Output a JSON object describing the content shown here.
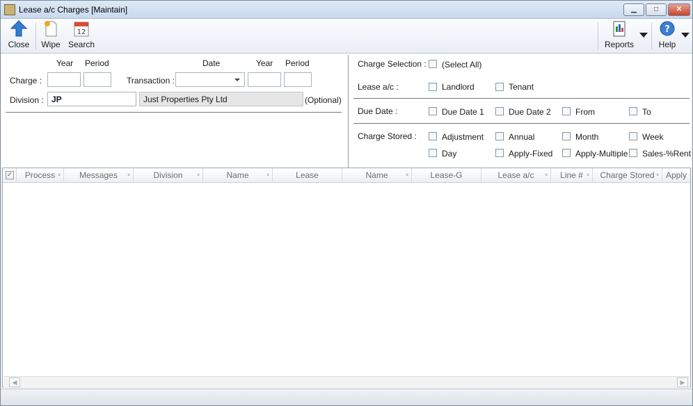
{
  "window": {
    "title": "Lease a/c Charges [Maintain]",
    "minimize_icon": "minimize-icon",
    "maximize_icon": "maximize-icon",
    "close_icon": "close-icon"
  },
  "toolbar": {
    "close_label": "Close",
    "wipe_label": "Wipe",
    "search_label": "Search",
    "reports_label": "Reports",
    "help_label": "Help"
  },
  "form": {
    "col_year_1": "Year",
    "col_period_1": "Period",
    "col_date": "Date",
    "col_year_2": "Year",
    "col_period_2": "Period",
    "charge_label": "Charge :",
    "transaction_label": "Transaction :",
    "division_label": "Division :",
    "division_value": "JP",
    "division_name": "Just Properties Pty Ltd",
    "optional_label": "(Optional)"
  },
  "selection": {
    "charge_selection_label": "Charge Selection :",
    "select_all": "(Select All)",
    "lease_ac_label": "Lease a/c :",
    "landlord": "Landlord",
    "tenant": "Tenant",
    "due_date_label": "Due Date :",
    "due_date_1": "Due Date 1",
    "due_date_2": "Due Date 2",
    "from": "From",
    "to": "To",
    "charge_stored_label": "Charge Stored :",
    "adjustment": "Adjustment",
    "annual": "Annual",
    "month": "Month",
    "week": "Week",
    "day": "Day",
    "apply_fixed": "Apply-Fixed",
    "apply_multiple": "Apply-Multiple",
    "sales_rent": "Sales-%Rent"
  },
  "grid": {
    "columns": [
      "Process",
      "Messages",
      "Division",
      "Name",
      "Lease",
      "Name",
      "Lease-G",
      "Lease a/c",
      "Line #",
      "Charge Stored",
      "Apply"
    ]
  }
}
